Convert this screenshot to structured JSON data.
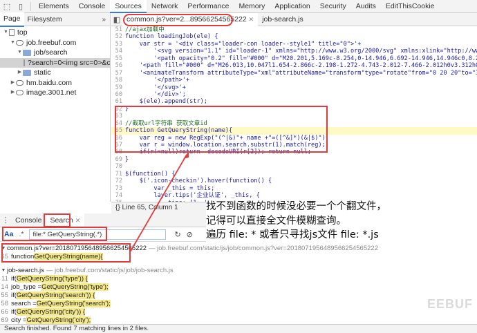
{
  "topbar": {
    "tabs": [
      "Elements",
      "Console",
      "Sources",
      "Network",
      "Performance",
      "Memory",
      "Application",
      "Security",
      "Audits",
      "EditThisCookie"
    ],
    "active_tab": "Sources"
  },
  "navigator": {
    "tabs": [
      "Page",
      "Filesystem"
    ],
    "more": "»",
    "tree": [
      {
        "label": "top",
        "indent": 0,
        "icon": "page-icon",
        "expanded": true
      },
      {
        "label": "job.freebuf.com",
        "indent": 1,
        "icon": "cloud-icon",
        "expanded": true
      },
      {
        "label": "job/search",
        "indent": 2,
        "icon": "folder-icon",
        "expanded": true
      },
      {
        "label": "?search=0<img src=0>&city",
        "indent": 3,
        "icon": "file-icon",
        "selected": true
      },
      {
        "label": "static",
        "indent": 2,
        "icon": "folder-icon",
        "expanded": false
      },
      {
        "label": "hm.baidu.com",
        "indent": 1,
        "icon": "cloud-icon",
        "expanded": false
      },
      {
        "label": "image.3001.net",
        "indent": 1,
        "icon": "cloud-icon",
        "expanded": false
      }
    ]
  },
  "editor": {
    "tabs": [
      {
        "label": "common.js?ver=2...89566254565222",
        "active": true
      },
      {
        "label": "job-search.js",
        "active": false
      }
    ],
    "lines": [
      {
        "n": "51",
        "text": "//ajax加载中",
        "cls": "cmt"
      },
      {
        "n": "52",
        "text": "function loadingJob(ele) {"
      },
      {
        "n": "53",
        "text": "    var str = '<div class=\"loader-con loader--style1\" title=\"0\">'+"
      },
      {
        "n": "54",
        "text": "        '<svg version=\"1.1\" id=\"loader-1\" xmlns=\"http://www.w3.org/2000/svg\" xmlns:xlink=\"http://www.w3.org/1"
      },
      {
        "n": "55",
        "text": "        '<path opacity=\"0.2\" fill=\"#000\" d=\"M20.201,5.169c-8.254,0-14.946,6.692-14.946,14.946c0,8.255,6.692,1"
      },
      {
        "n": "56",
        "text": "    '<path fill=\"#000\" d=\"M26.013,10.047l1.654-2.866c-2.198-1.272-4.743-2.012-7.466-2.012h0v3.312h0C22.32,8.4"
      },
      {
        "n": "57",
        "text": "    '<animateTransform attributeType=\"xml\"attributeName=\"transform\"type=\"rotate\"from=\"0 20 20\"to=\"360 20 20\"d"
      },
      {
        "n": "58",
        "text": "        '</path>'+"
      },
      {
        "n": "59",
        "text": "        '</svg>'+"
      },
      {
        "n": "60",
        "text": "        '</div>';"
      },
      {
        "n": "61",
        "text": "    $(ele).append(str);"
      },
      {
        "n": "62",
        "text": "}"
      },
      {
        "n": "63",
        "text": ""
      },
      {
        "n": "64",
        "text": "//截取url字符串 获取文章id",
        "cls": "cmt"
      },
      {
        "n": "65",
        "text": "function GetQueryString(name){",
        "hl": true
      },
      {
        "n": "66",
        "text": "    var reg = new RegExp(\"(^|&)\"+ name +\"=([^&]*)(&|$)\");"
      },
      {
        "n": "67",
        "text": "    var r = window.location.search.substr(1).match(reg);"
      },
      {
        "n": "68",
        "text": "    if(r!=null)return  decodeURI(r[2]); return null;"
      },
      {
        "n": "69",
        "text": "}"
      },
      {
        "n": "70",
        "text": ""
      },
      {
        "n": "71",
        "text": "$(function() {"
      },
      {
        "n": "72",
        "text": "    $('.icon-checkin').hover(function() {"
      },
      {
        "n": "73",
        "text": "        var _this = this;"
      },
      {
        "n": "74",
        "text": "        layer.tips('企业认证', _this, {"
      },
      {
        "n": "75",
        "text": "            tips: [1, '#242321']"
      },
      {
        "n": "76",
        "text": "        });"
      }
    ]
  },
  "status_bar": {
    "text": "{}   Line 65, Column 1"
  },
  "drawer": {
    "tabs": [
      "Console",
      "Search"
    ],
    "active_tab": "Search",
    "aa_label": "Aa",
    "regex_label": ".*",
    "search_value": "file:* GetQueryString(.*)",
    "refresh_icon": "↻",
    "clear_icon": "⊘"
  },
  "results": {
    "files": [
      {
        "name": "common.js?ver=20180719564895662545652​22",
        "path": "— job.freebuf.com/static/js/job/common.js?ver=2018071956489566254565222",
        "lines": [
          {
            "n": "65",
            "before": "function ",
            "match": "GetQueryString(name){",
            "after": ""
          }
        ]
      },
      {
        "name": "job-search.js",
        "path": "— job.freebuf.com/static/js/job/job-search.js",
        "lines": [
          {
            "n": "11",
            "before": "if(",
            "match": "GetQueryString('type')) {",
            "after": ""
          },
          {
            "n": "14",
            "before": "job_type = ",
            "match": "GetQueryString('type');",
            "after": ""
          },
          {
            "n": "55",
            "before": "if(",
            "match": "GetQueryString('search')) {",
            "after": ""
          },
          {
            "n": "58",
            "before": "search = ",
            "match": "GetQueryString('search');",
            "after": ""
          },
          {
            "n": "66",
            "before": "if(",
            "match": "GetQueryString('city')) {",
            "after": ""
          },
          {
            "n": "69",
            "before": "city = ",
            "match": "GetQueryString('city');",
            "after": ""
          }
        ]
      }
    ]
  },
  "footer": {
    "text": "Search finished.  Found 7 matching lines in 2 files."
  },
  "annotation": {
    "lines": [
      "找不到函数的时候没必要一个个翻文件，",
      "记得可以直接全文件模糊查询。",
      "遍历 file: * 或者只寻找js文件 file: *.js"
    ],
    "highlight_color": "#e23b3b"
  },
  "watermark": "EEBUF"
}
